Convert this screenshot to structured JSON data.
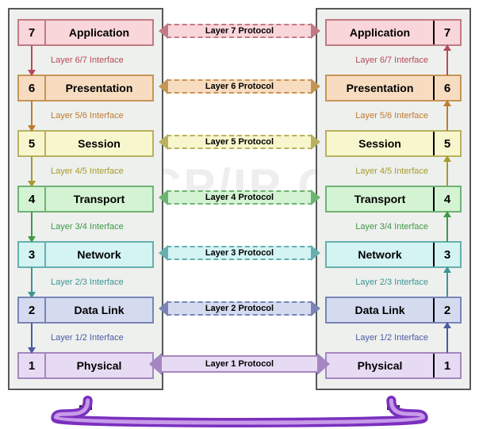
{
  "watermark": "The TCP/IP Guide",
  "layers": [
    {
      "num": "7",
      "name": "Application",
      "protocol": "Layer 7 Protocol",
      "interface": "Layer 6/7 Interface"
    },
    {
      "num": "6",
      "name": "Presentation",
      "protocol": "Layer 6 Protocol",
      "interface": "Layer 5/6 Interface"
    },
    {
      "num": "5",
      "name": "Session",
      "protocol": "Layer 5 Protocol",
      "interface": "Layer 4/5 Interface"
    },
    {
      "num": "4",
      "name": "Transport",
      "protocol": "Layer 4 Protocol",
      "interface": "Layer 3/4 Interface"
    },
    {
      "num": "3",
      "name": "Network",
      "protocol": "Layer 3 Protocol",
      "interface": "Layer 2/3 Interface"
    },
    {
      "num": "2",
      "name": "Data Link",
      "protocol": "Layer 2 Protocol",
      "interface": "Layer 1/2 Interface"
    },
    {
      "num": "1",
      "name": "Physical",
      "protocol": "Layer 1 Protocol",
      "interface": ""
    }
  ]
}
